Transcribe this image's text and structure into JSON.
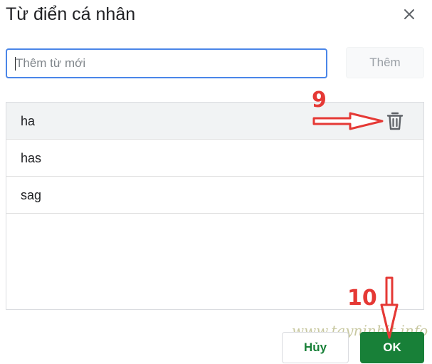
{
  "dialog": {
    "title": "Từ điển cá nhân",
    "close_icon": "close-icon"
  },
  "new_word": {
    "placeholder": "Thêm từ mới",
    "value": ""
  },
  "add_button": {
    "label": "Thêm"
  },
  "words": [
    {
      "text": "ha"
    },
    {
      "text": "has"
    },
    {
      "text": "sag"
    }
  ],
  "row_actions": {
    "delete_icon": "trash-icon"
  },
  "footer": {
    "cancel_label": "Hủy",
    "ok_label": "OK"
  },
  "annotations": {
    "step_9": "9",
    "step_10": "10",
    "watermark": "www.tayninhit.info",
    "color": "#e53935"
  },
  "colors": {
    "accent_green": "#188038",
    "focus_blue": "#4a86e8"
  }
}
